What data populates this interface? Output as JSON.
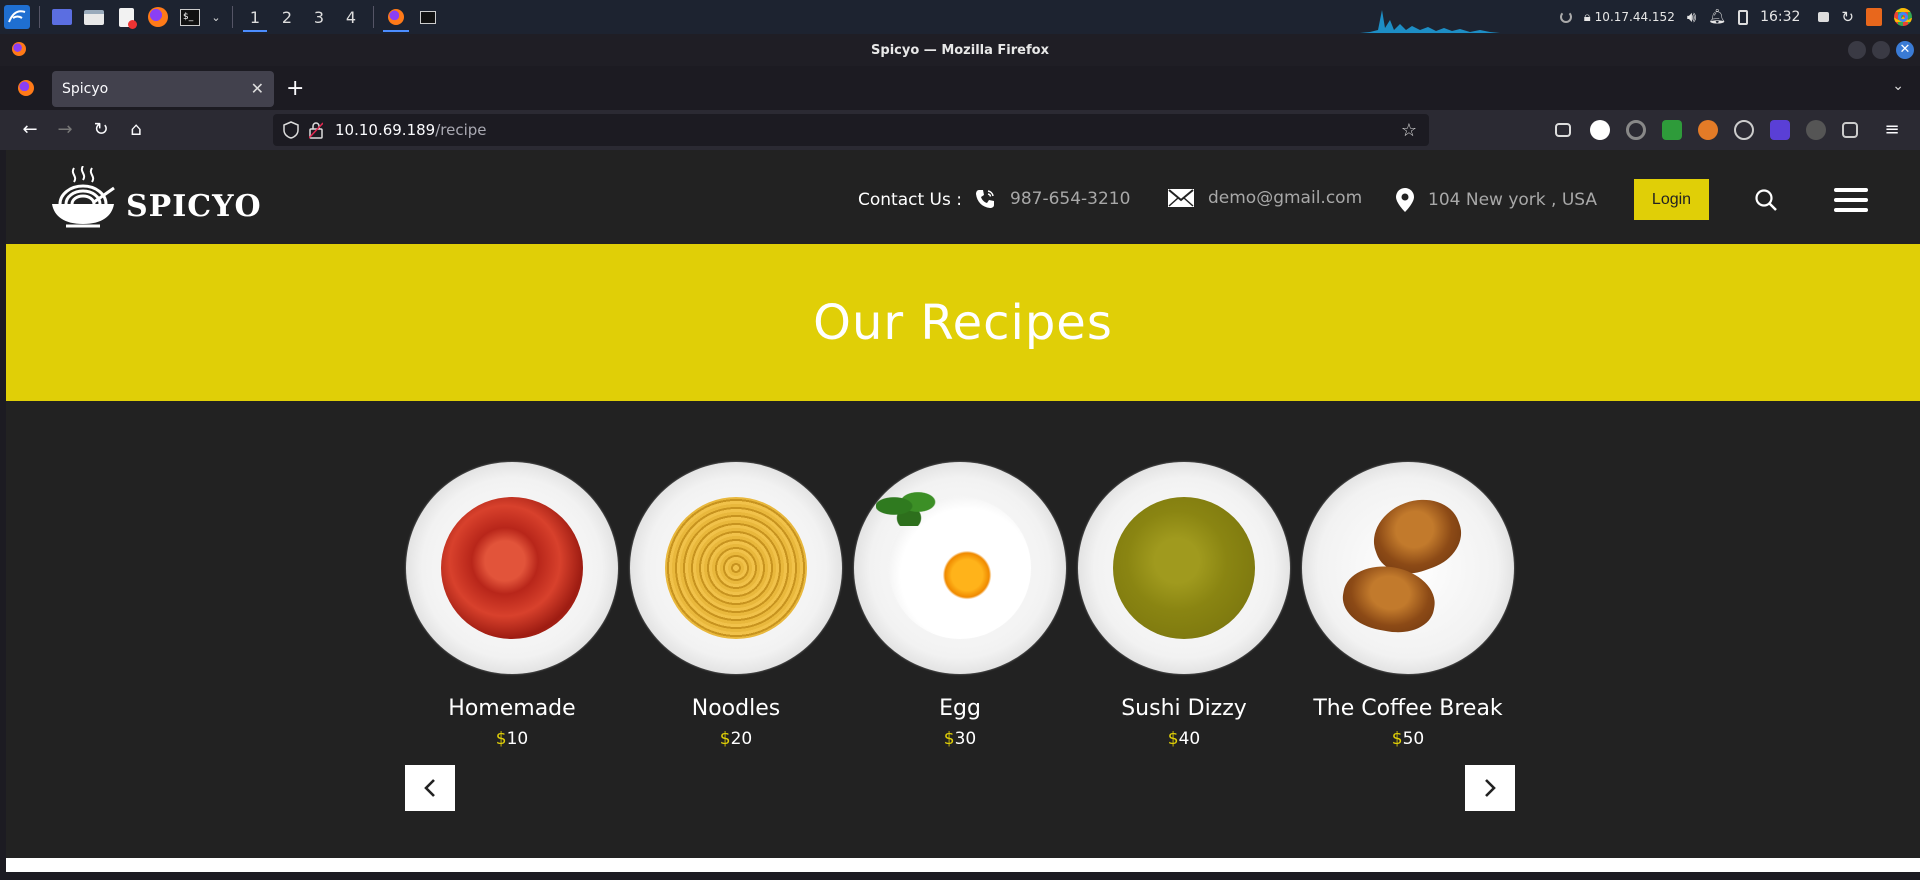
{
  "taskbar": {
    "workspaces": [
      "1",
      "2",
      "3",
      "4"
    ],
    "active_workspace": "1",
    "ip": "10.17.44.152",
    "time": "16:32",
    "accent": "#4c8dff"
  },
  "browser": {
    "window_title": "Spicyo — Mozilla Firefox",
    "tab_title": "Spicyo",
    "url_host": "10.10.69.189",
    "url_path": "/recipe"
  },
  "site": {
    "brand": "SPICYO",
    "contact_label": "Contact Us :",
    "phone": "987-654-3210",
    "email": "demo@gmail.com",
    "address": "104 New york , USA",
    "login_label": "Login",
    "accent_color": "#e0cf07",
    "background_color": "#222222",
    "banner_title": "Our Recipes",
    "recipes": [
      {
        "name": "Homemade",
        "currency": "$",
        "price": "10",
        "icon": "tomato-soup"
      },
      {
        "name": "Noodles",
        "currency": "$",
        "price": "20",
        "icon": "spaghetti"
      },
      {
        "name": "Egg",
        "currency": "$",
        "price": "30",
        "icon": "fried-egg"
      },
      {
        "name": "Sushi Dizzy",
        "currency": "$",
        "price": "40",
        "icon": "green-soup"
      },
      {
        "name": "The Coffee Break",
        "currency": "$",
        "price": "50",
        "icon": "croissants"
      }
    ]
  }
}
